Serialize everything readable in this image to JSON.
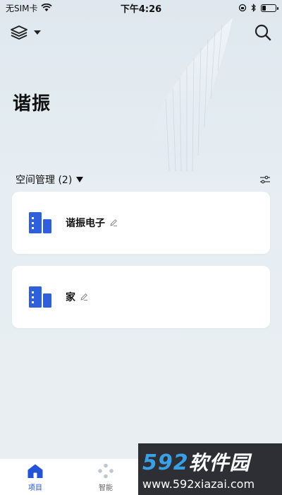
{
  "status_bar": {
    "carrier": "无SIM卡",
    "time": "下午4:26",
    "battery_level": 0.3
  },
  "header": {
    "layers_icon": "layers-icon",
    "search_icon": "search-icon"
  },
  "page_title": "谐振",
  "section": {
    "title": "空间管理 (2)",
    "filter_icon": "sliders-icon"
  },
  "spaces": [
    {
      "name": "谐振电子"
    },
    {
      "name": "家"
    }
  ],
  "tabs": [
    {
      "label": "项目",
      "icon": "home-icon",
      "active": true
    },
    {
      "label": "智能",
      "icon": "dots-icon",
      "active": false
    }
  ],
  "watermark": {
    "number": "592",
    "name": "软件园",
    "url": "www.592xiazai.com"
  },
  "colors": {
    "accent": "#2353d6",
    "card_icon": "#2f5fd9",
    "background": "#e6eef3"
  }
}
